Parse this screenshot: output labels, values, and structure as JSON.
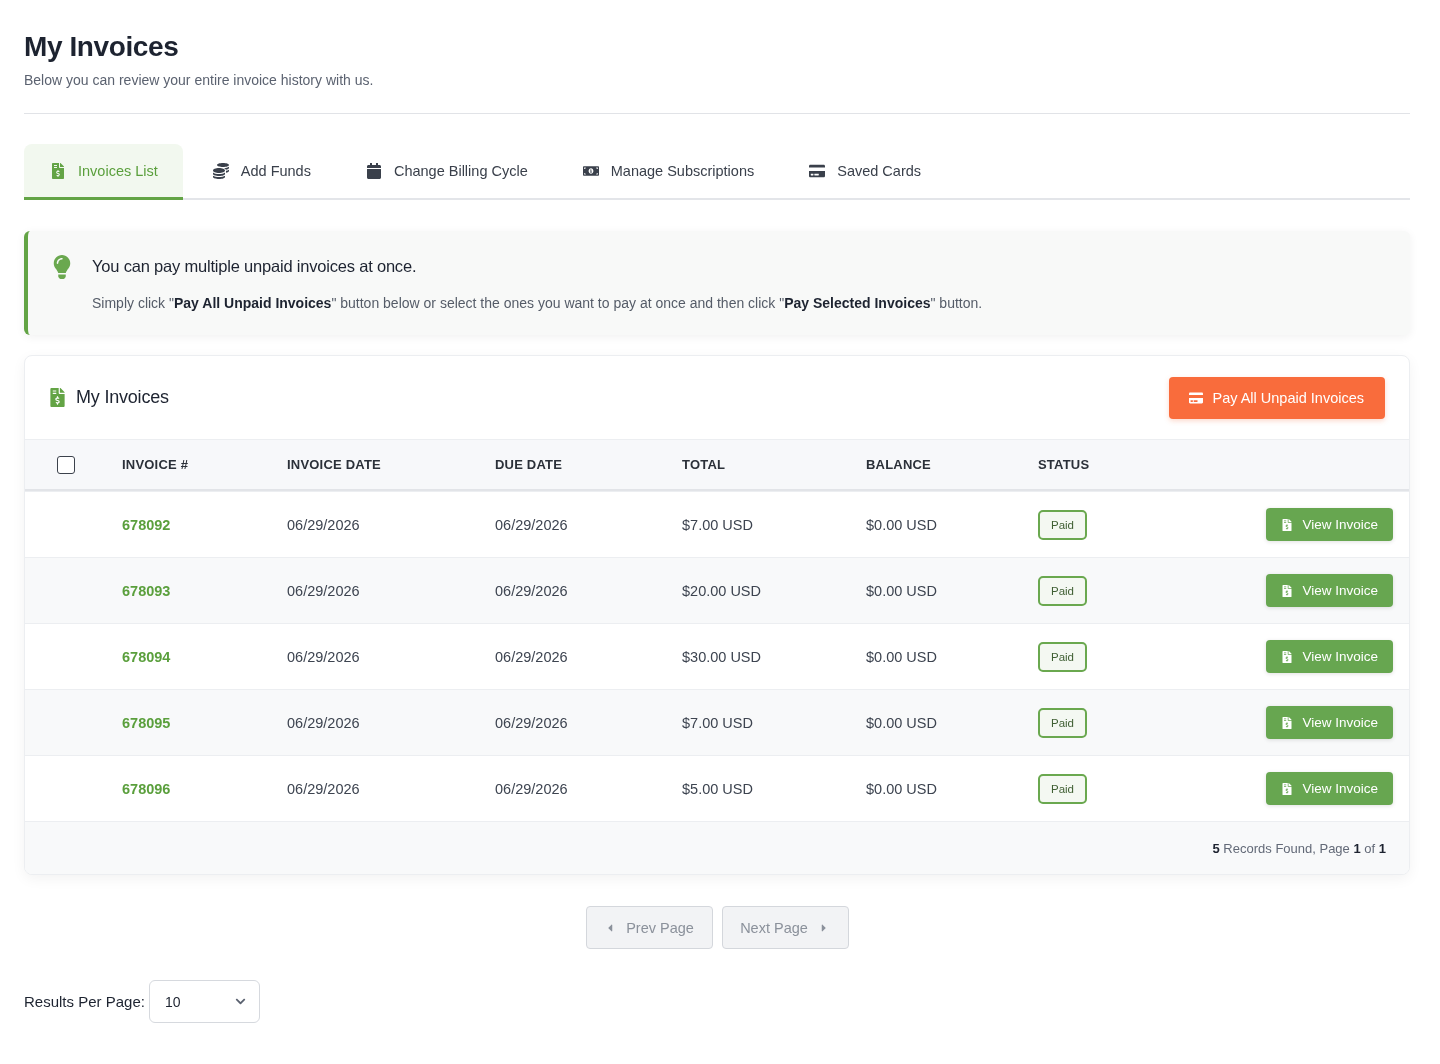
{
  "page": {
    "title": "My Invoices",
    "subtitle": "Below you can review your entire invoice history with us."
  },
  "tabs": [
    {
      "label": "Invoices List",
      "kind": "invoice",
      "selected": true
    },
    {
      "label": "Add Funds",
      "kind": "coins",
      "selected": false
    },
    {
      "label": "Change Billing Cycle",
      "kind": "calendar",
      "selected": false
    },
    {
      "label": "Manage Subscriptions",
      "kind": "money",
      "selected": false
    },
    {
      "label": "Saved Cards",
      "kind": "card",
      "selected": false
    }
  ],
  "notice": {
    "title": "You can pay multiple unpaid invoices at once.",
    "text": "Simply click \"**Pay All Unpaid Invoices**\" button below or select the ones you want to pay at once and then click \"**Pay Selected Invoices**\" button."
  },
  "panel": {
    "title": "My Invoices",
    "pay_button": "Pay All Unpaid Invoices"
  },
  "table": {
    "select_all": {
      "checked": false
    },
    "columns": [
      "INVOICE #",
      "INVOICE DATE",
      "DUE DATE",
      "TOTAL",
      "BALANCE",
      "STATUS"
    ],
    "rows": [
      {
        "invoice": "678092",
        "invoice_date": "06/29/2026",
        "due_date": "06/29/2026",
        "total": "$7.00 USD",
        "balance": "$0.00 USD",
        "status": "Paid",
        "action": "View Invoice"
      },
      {
        "invoice": "678093",
        "invoice_date": "06/29/2026",
        "due_date": "06/29/2026",
        "total": "$20.00 USD",
        "balance": "$0.00 USD",
        "status": "Paid",
        "action": "View Invoice"
      },
      {
        "invoice": "678094",
        "invoice_date": "06/29/2026",
        "due_date": "06/29/2026",
        "total": "$30.00 USD",
        "balance": "$0.00 USD",
        "status": "Paid",
        "action": "View Invoice"
      },
      {
        "invoice": "678095",
        "invoice_date": "06/29/2026",
        "due_date": "06/29/2026",
        "total": "$7.00 USD",
        "balance": "$0.00 USD",
        "status": "Paid",
        "action": "View Invoice"
      },
      {
        "invoice": "678096",
        "invoice_date": "06/29/2026",
        "due_date": "06/29/2026",
        "total": "$5.00 USD",
        "balance": "$0.00 USD",
        "status": "Paid",
        "action": "View Invoice"
      }
    ],
    "summary": "**5** Records Found, Page **1** of **1**"
  },
  "pagination": {
    "prev": {
      "label": "Prev Page",
      "disabled": true
    },
    "next": {
      "label": "Next Page",
      "disabled": true
    }
  },
  "per_page": {
    "label": "Results Per Page:",
    "value": "10"
  }
}
